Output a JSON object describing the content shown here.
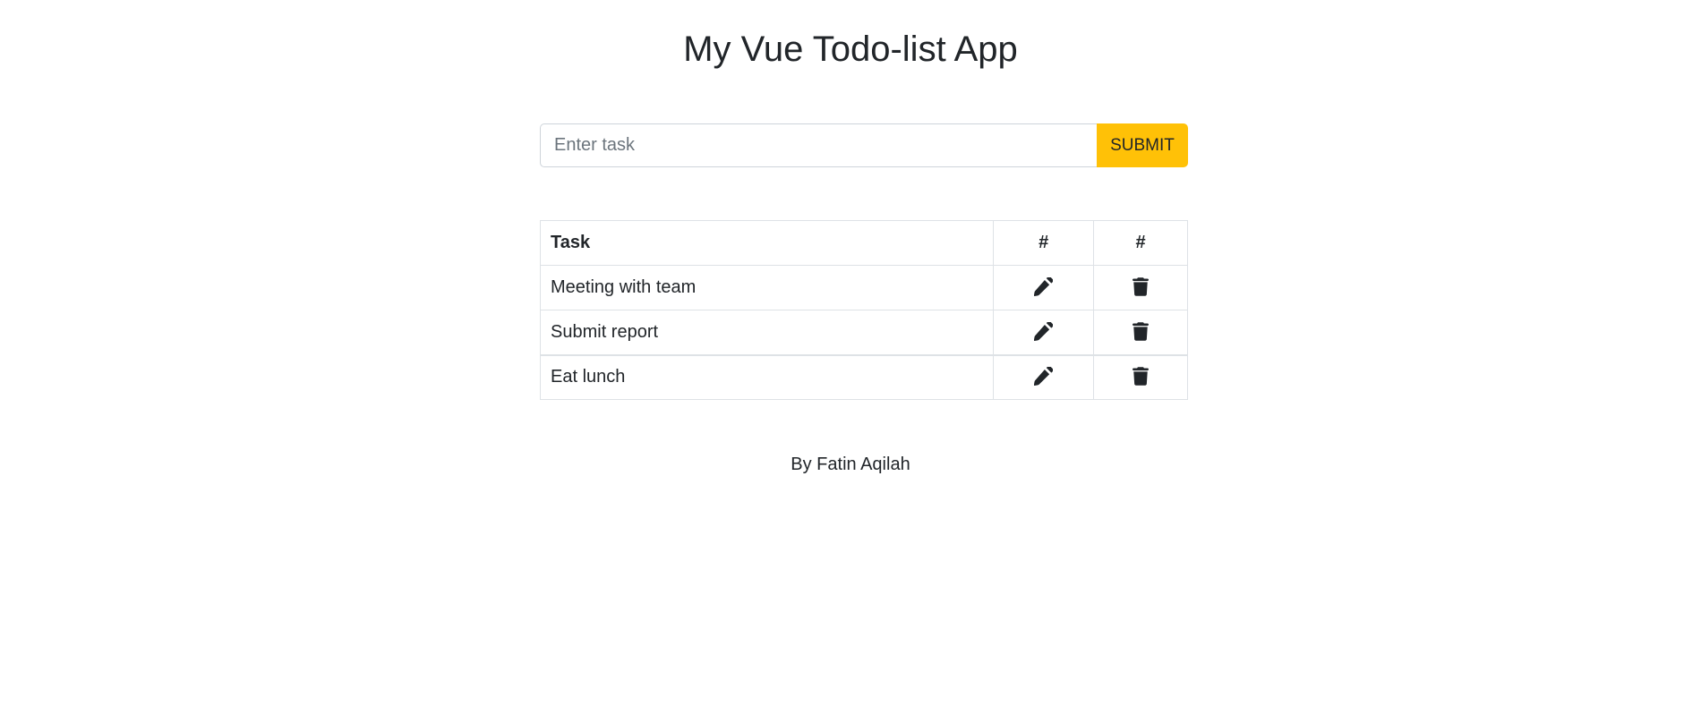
{
  "app": {
    "title": "My Vue Todo-list App"
  },
  "form": {
    "input_value": "",
    "input_placeholder": "Enter task",
    "submit_label": "SUBMIT",
    "submit_color": "#ffc107"
  },
  "table": {
    "headers": [
      "Task",
      "#",
      "#"
    ],
    "rows": [
      {
        "task": "Meeting with team",
        "edit_icon": "pencil-icon",
        "delete_icon": "trash-icon"
      },
      {
        "task": "Submit report",
        "edit_icon": "pencil-icon",
        "delete_icon": "trash-icon"
      },
      {
        "task": "Eat lunch",
        "edit_icon": "pencil-icon",
        "delete_icon": "trash-icon"
      }
    ]
  },
  "footer": {
    "text": "By Fatin Aqilah"
  }
}
